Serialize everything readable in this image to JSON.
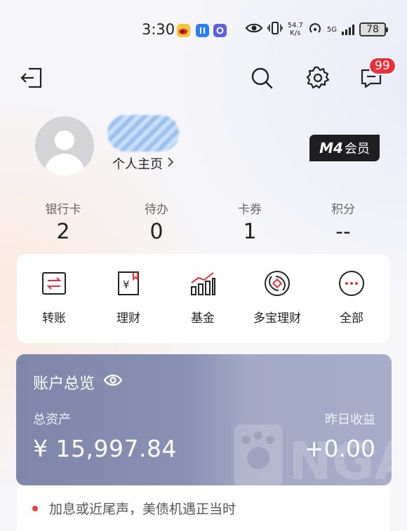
{
  "status_bar": {
    "time": "3:30",
    "net_speed_value": "54.7",
    "net_speed_unit": "K/s",
    "network_label": "5G",
    "battery": "78",
    "icons": [
      "weibo-icon",
      "app-icon",
      "app-icon",
      "eye-icon",
      "vibrate-icon",
      "hotspot-icon",
      "signal-icon",
      "battery-icon"
    ]
  },
  "top_nav": {
    "icons": [
      "exit-icon",
      "search-icon",
      "settings-icon",
      "message-icon"
    ],
    "message_badge": "99"
  },
  "profile": {
    "homepage_label": "个人主页",
    "member_level": "M4",
    "member_label": "会员"
  },
  "stats": [
    {
      "label": "银行卡",
      "value": "2"
    },
    {
      "label": "待办",
      "value": "0"
    },
    {
      "label": "卡券",
      "value": "1"
    },
    {
      "label": "积分",
      "value": "--"
    }
  ],
  "quick_actions": [
    {
      "label": "转账",
      "icon": "transfer-icon"
    },
    {
      "label": "理财",
      "icon": "wealth-icon"
    },
    {
      "label": "基金",
      "icon": "fund-chart-icon"
    },
    {
      "label": "多宝理财",
      "icon": "duobao-icon"
    },
    {
      "label": "全部",
      "icon": "more-icon"
    }
  ],
  "account": {
    "title": "账户总览",
    "total_assets_label": "总资产",
    "total_assets_value": "¥ 15,997.84",
    "yesterday_income_label": "昨日收益",
    "yesterday_income_value": "+0.00",
    "watermark_text": "NGA"
  },
  "ticker": {
    "text": "加息或近尾声，美债机遇正当时"
  },
  "colors": {
    "accent_red": "#e8313a",
    "card_gradient_start": "#7f86aa",
    "card_gradient_end": "#a7adc8"
  }
}
